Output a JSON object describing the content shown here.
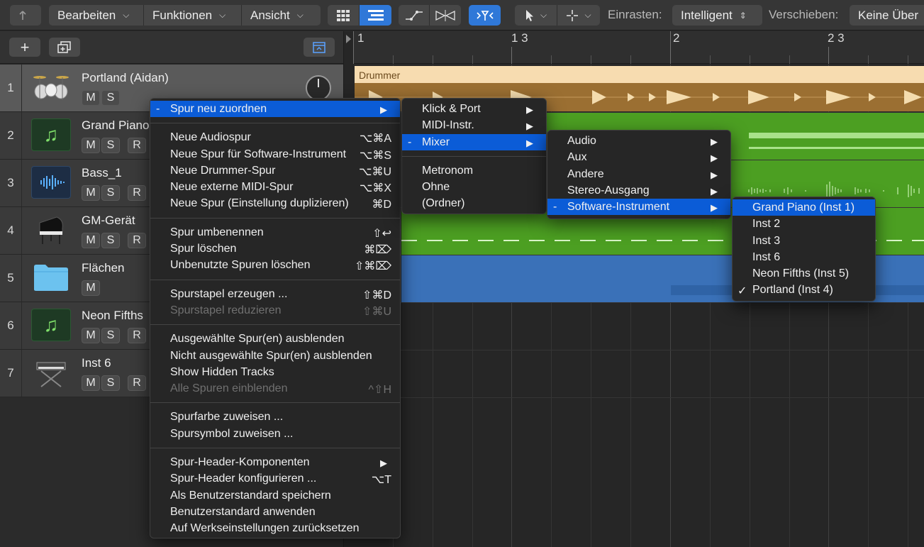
{
  "toolbar": {
    "menus": [
      "Bearbeiten",
      "Funktionen",
      "Ansicht"
    ],
    "snap_label": "Einrasten:",
    "snap_value": "Intelligent",
    "drag_label": "Verschieben:",
    "drag_value": "Keine Über",
    "icons": [
      "back-arrow-icon",
      "grid-view-icon",
      "list-view-icon",
      "automation-curve-icon",
      "flex-icon",
      "catch-icon",
      "pointer-tool-icon",
      "marquee-tool-icon"
    ]
  },
  "ruler": {
    "marks": [
      "1",
      "1 3",
      "2",
      "2 3"
    ]
  },
  "tracks": [
    {
      "num": "1",
      "name": "Portland (Aidan)",
      "icon": "drum-kit-icon",
      "buttons": [
        "M",
        "S"
      ]
    },
    {
      "num": "2",
      "name": "Grand Piano",
      "icon": "music-note-icon",
      "buttons": [
        "M",
        "S",
        "R"
      ]
    },
    {
      "num": "3",
      "name": "Bass_1",
      "icon": "waveform-icon",
      "buttons": [
        "M",
        "S",
        "R"
      ]
    },
    {
      "num": "4",
      "name": "GM-Gerät",
      "icon": "grand-piano-icon",
      "buttons": [
        "M",
        "S",
        "R"
      ]
    },
    {
      "num": "5",
      "name": "Flächen",
      "icon": "folder-icon",
      "buttons": [
        "M"
      ]
    },
    {
      "num": "6",
      "name": "Neon Fifths",
      "icon": "music-note-icon",
      "buttons": [
        "M",
        "S",
        "R"
      ]
    },
    {
      "num": "7",
      "name": "Inst 6",
      "icon": "keyboard-stand-icon",
      "buttons": [
        "M",
        "S",
        "R"
      ]
    }
  ],
  "regions": {
    "drummer_label": "Drummer"
  },
  "context_menu": {
    "groups": [
      [
        {
          "label": "Spur neu zuordnen",
          "submenu": true,
          "highlighted": true,
          "dash": "-"
        }
      ],
      [
        {
          "label": "Neue Audiospur",
          "shortcut": "⌥⌘A"
        },
        {
          "label": "Neue Spur für Software-Instrument",
          "shortcut": "⌥⌘S"
        },
        {
          "label": "Neue Drummer-Spur",
          "shortcut": "⌥⌘U"
        },
        {
          "label": "Neue externe MIDI-Spur",
          "shortcut": "⌥⌘X"
        },
        {
          "label": "Neue Spur (Einstellung duplizieren)",
          "shortcut": "⌘D"
        }
      ],
      [
        {
          "label": "Spur umbenennen",
          "shortcut": "⇧↩"
        },
        {
          "label": "Spur löschen",
          "shortcut": "⌘⌦"
        },
        {
          "label": "Unbenutzte Spuren löschen",
          "shortcut": "⇧⌘⌦"
        }
      ],
      [
        {
          "label": "Spurstapel erzeugen ...",
          "shortcut": "⇧⌘D"
        },
        {
          "label": "Spurstapel reduzieren",
          "shortcut": "⇧⌘U",
          "disabled": true
        }
      ],
      [
        {
          "label": "Ausgewählte Spur(en) ausblenden"
        },
        {
          "label": "Nicht ausgewählte Spur(en) ausblenden"
        },
        {
          "label": "Show Hidden Tracks"
        },
        {
          "label": "Alle Spuren einblenden",
          "shortcut": "^⇧H",
          "disabled": true
        }
      ],
      [
        {
          "label": "Spurfarbe zuweisen ..."
        },
        {
          "label": "Spursymbol zuweisen ..."
        }
      ],
      [
        {
          "label": "Spur-Header-Komponenten",
          "submenu": true
        },
        {
          "label": "Spur-Header konfigurieren ...",
          "shortcut": "⌥T"
        },
        {
          "label": "Als Benutzerstandard speichern"
        },
        {
          "label": "Benutzerstandard anwenden"
        },
        {
          "label": "Auf Werkseinstellungen zurücksetzen"
        }
      ]
    ]
  },
  "submenu_1": {
    "groups": [
      [
        {
          "label": "Klick & Port",
          "submenu": true
        },
        {
          "label": "MIDI-Instr.",
          "submenu": true
        },
        {
          "label": "Mixer",
          "submenu": true,
          "highlighted": true,
          "dash": "-"
        }
      ],
      [
        {
          "label": "Metronom"
        },
        {
          "label": "Ohne"
        },
        {
          "label": "(Ordner)"
        }
      ]
    ]
  },
  "submenu_2": {
    "groups": [
      [
        {
          "label": "Audio",
          "submenu": true
        },
        {
          "label": "Aux",
          "submenu": true
        },
        {
          "label": "Andere",
          "submenu": true
        },
        {
          "label": "Stereo-Ausgang",
          "submenu": true
        },
        {
          "label": "Software-Instrument",
          "submenu": true,
          "highlighted": true,
          "dash": "-"
        }
      ]
    ]
  },
  "submenu_3": {
    "groups": [
      [
        {
          "label": "Grand Piano (Inst 1)",
          "highlighted": true
        },
        {
          "label": "Inst 2"
        },
        {
          "label": "Inst 3"
        },
        {
          "label": "Inst 6"
        },
        {
          "label": "Neon Fifths (Inst 5)"
        },
        {
          "label": "Portland (Inst 4)",
          "checked": true
        }
      ]
    ]
  }
}
